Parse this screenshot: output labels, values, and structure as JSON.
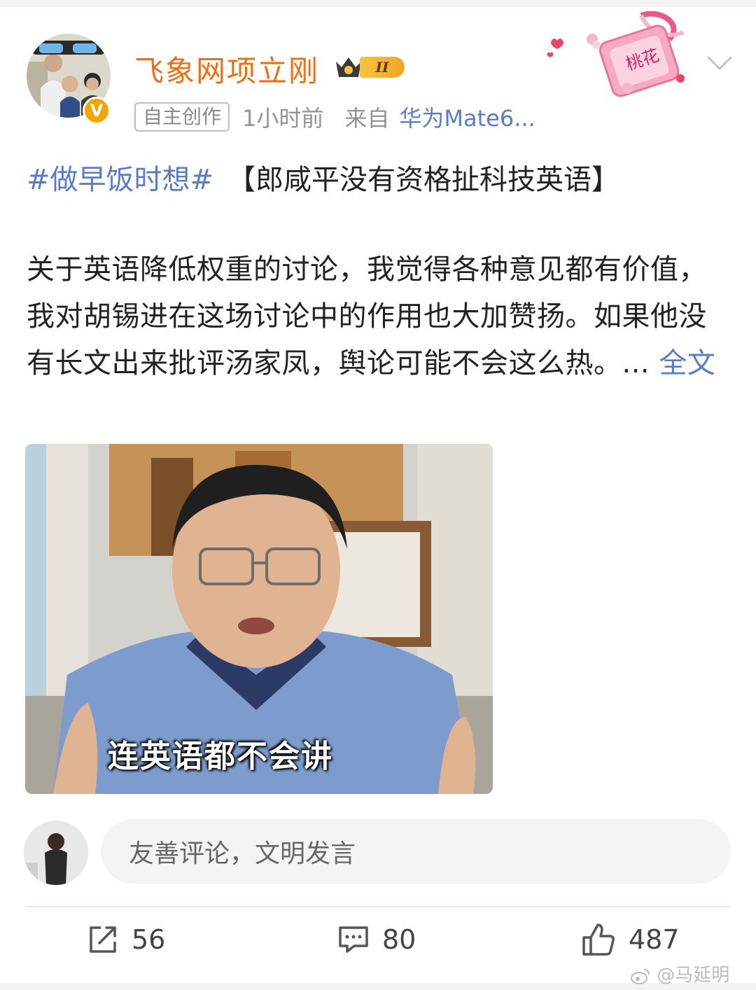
{
  "post": {
    "author": "飞象网项立刚",
    "level": "II",
    "verified_mark": "V",
    "tag": "自主创作",
    "time": "1小时前",
    "from_label": "来自",
    "device": "华为Mate6...",
    "sticker_text": "桃花",
    "hashtag": "#做早饭时想#",
    "title": "【郎咸平没有资格扯科技英语】",
    "body": "关于英语降低权重的讨论，我觉得各种意见都有价值，我对胡锡进在这场讨论中的作用也大加赞扬。如果他没有长文出来批评汤家凤，舆论可能不会这么热。...",
    "more_label": "全文",
    "image_caption": "连英语都不会讲"
  },
  "comment": {
    "placeholder": "友善评论，文明发言"
  },
  "actions": {
    "repost_count": "56",
    "comment_count": "80",
    "like_count": "487"
  },
  "watermark": "@马延明",
  "icons": {
    "repost": "share-icon",
    "comment": "comment-icon",
    "like": "thumbs-up-icon",
    "expand": "chevron-down-icon",
    "watermark": "weibo-logo-icon"
  },
  "colors": {
    "username": "#f26d0f",
    "link": "#5a7cc4",
    "badge": "#f5a300"
  }
}
